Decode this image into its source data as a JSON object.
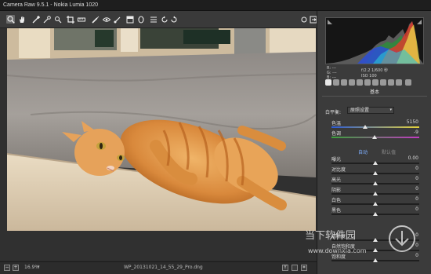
{
  "window": {
    "title": "Camera Raw 9.5.1  -  Nokia Lumia 1020"
  },
  "toolbar": {
    "tools": [
      "zoom",
      "hand",
      "white-balance",
      "color-sampler",
      "targeted-adjustment",
      "crop",
      "straighten",
      "spot-removal",
      "red-eye",
      "adjustment-brush",
      "graduated-filter",
      "radial-filter",
      "open-preferences",
      "rotate-ccw",
      "rotate-cw"
    ],
    "right_icons": [
      "toggle-icon",
      "fullscreen-icon"
    ]
  },
  "status": {
    "zoom": "16.9%",
    "filename": "WP_20131021_14_55_29_Pro.dng",
    "y_label": "Y",
    "settings_icon": "settings-icon"
  },
  "histogram": {
    "rgb_r": "R:  ---",
    "rgb_g": "G:  ---",
    "rgb_b": "B:  ---",
    "aperture_shutter": "f/2.2   1/600 秒",
    "iso_focal": "ISO 100"
  },
  "panel": {
    "section_title": "基本",
    "wb_label": "白平衡:",
    "wb_value": "原照设置",
    "auto_label": "自动",
    "default_label": "默认值",
    "sliders": [
      {
        "label": "色温",
        "value": "5150",
        "level": 0.38
      },
      {
        "label": "色调",
        "value": "-9",
        "level": 0.49
      },
      {
        "label": "曝光",
        "value": "0.00",
        "level": 0.5
      },
      {
        "label": "对比度",
        "value": "0",
        "level": 0.5
      },
      {
        "label": "高光",
        "value": "0",
        "level": 0.5
      },
      {
        "label": "阴影",
        "value": "0",
        "level": 0.5
      },
      {
        "label": "白色",
        "value": "0",
        "level": 0.5
      },
      {
        "label": "黑色",
        "value": "0",
        "level": 0.5
      },
      {
        "label": "清晰度",
        "value": "0",
        "level": 0.5
      },
      {
        "label": "自然饱和度",
        "value": "0",
        "level": 0.5
      },
      {
        "label": "饱和度",
        "value": "0",
        "level": 0.5
      }
    ]
  },
  "watermark": {
    "text_cn": "当下软件园",
    "text_url": "www.downxia.com"
  },
  "colors": {
    "accent": "#f0f0f0",
    "temp_gradient_start": "#2b5ad6",
    "temp_gradient_end": "#e6d43a",
    "tint_gradient_start": "#3aa13a",
    "tint_gradient_end": "#c23ac2"
  }
}
